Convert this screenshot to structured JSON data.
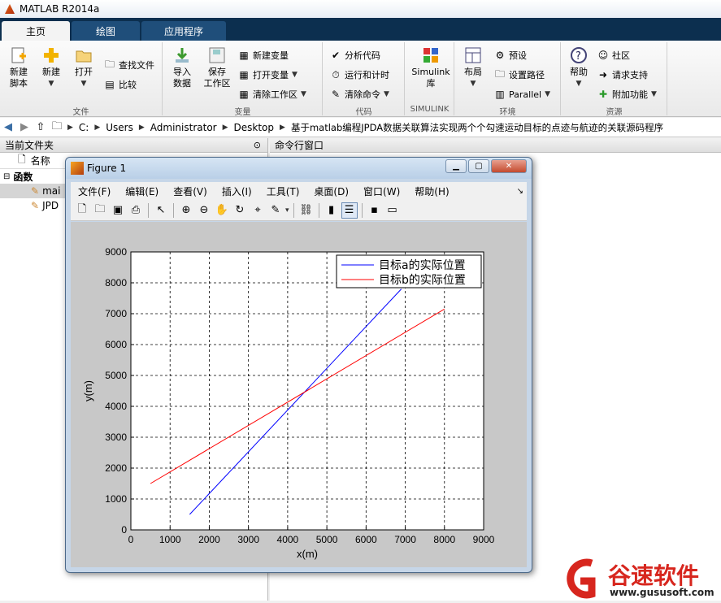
{
  "window": {
    "title": "MATLAB R2014a"
  },
  "tabs": [
    {
      "label": "主页",
      "active": true
    },
    {
      "label": "绘图",
      "active": false
    },
    {
      "label": "应用程序",
      "active": false
    }
  ],
  "ribbon": {
    "file": {
      "label": "文件",
      "new_script": "新建\n脚本",
      "new": "新建",
      "open": "打开",
      "find_files": "查找文件",
      "compare": "比较"
    },
    "variable": {
      "label": "变量",
      "import": "导入\n数据",
      "save_ws": "保存\n工作区",
      "new_var": "新建变量",
      "open_var": "打开变量",
      "clear_ws": "清除工作区"
    },
    "code": {
      "label": "代码",
      "analyze": "分析代码",
      "run_time": "运行和计时",
      "clear_cmd": "清除命令"
    },
    "simulink": {
      "label": "SIMULINK",
      "btn": "Simulink\n库"
    },
    "env": {
      "label": "环境",
      "layout": "布局",
      "prefs": "预设",
      "set_path": "设置路径",
      "parallel": "Parallel"
    },
    "resources": {
      "label": "资源",
      "help": "帮助",
      "community": "社区",
      "support": "请求支持",
      "addons": "附加功能"
    }
  },
  "path": [
    "C:",
    "Users",
    "Administrator",
    "Desktop",
    "基于matlab编程JPDA数据关联算法实现两个个勾速运动目标的点迹与航迹的关联源码程序"
  ],
  "left_pane": {
    "title": "当前文件夹",
    "col_name": "名称",
    "group": "函数",
    "files": [
      "mai",
      "JPD"
    ]
  },
  "right_pane": {
    "title": "命令行窗口"
  },
  "figure": {
    "title": "Figure 1",
    "menu": [
      "文件(F)",
      "编辑(E)",
      "查看(V)",
      "插入(I)",
      "工具(T)",
      "桌面(D)",
      "窗口(W)",
      "帮助(H)"
    ]
  },
  "chart_data": {
    "type": "line",
    "xlabel": "x(m)",
    "ylabel": "y(m)",
    "xlim": [
      0,
      9000
    ],
    "ylim": [
      0,
      9000
    ],
    "xticks": [
      0,
      1000,
      2000,
      3000,
      4000,
      5000,
      6000,
      7000,
      8000,
      9000
    ],
    "yticks": [
      0,
      1000,
      2000,
      3000,
      4000,
      5000,
      6000,
      7000,
      8000,
      9000
    ],
    "grid": true,
    "legend_position": "top-right",
    "series": [
      {
        "name": "目标a的实际位置",
        "color": "#0000ff",
        "x": [
          1500,
          6900
        ],
        "y": [
          500,
          7800
        ]
      },
      {
        "name": "目标b的实际位置",
        "color": "#ff0000",
        "x": [
          500,
          8000
        ],
        "y": [
          1500,
          7150
        ]
      }
    ]
  },
  "watermark": {
    "brand": "谷速软件",
    "url": "www.gususoft.com",
    "color": "#d7261e"
  }
}
